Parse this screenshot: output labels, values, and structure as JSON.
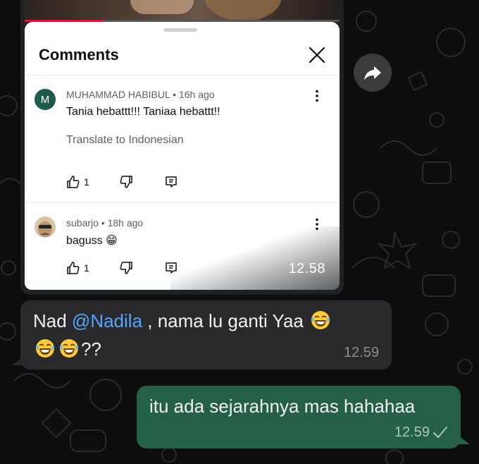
{
  "media": {
    "video_progress_fraction": 0.25,
    "comments_title": "Comments",
    "time": "12.58",
    "comments": [
      {
        "avatar_letter": "M",
        "avatar_color": "#1d5c4a",
        "author_meta": "MUHAMMAD HABIBUL • 16h ago",
        "text": "Tania hebattt!!! Taniaa hebattt!!",
        "translate": "Translate to Indonesian",
        "likes": "1"
      },
      {
        "avatar_color": "#c9b08f",
        "author_meta": "subarjo • 18h ago",
        "text": "baguss 😁",
        "likes": "1"
      }
    ]
  },
  "incoming_message": {
    "prefix": "Nad ",
    "mention": "@Nadila",
    "after_mention": " , nama lu ganti Yaa",
    "line2_suffix": "??",
    "time": "12.59"
  },
  "outgoing_message": {
    "text": "itu ada sejarahnya mas hahahaa",
    "time": "12.59",
    "status": "sent"
  },
  "colors": {
    "incoming_bubble": "#2a2a2c",
    "outgoing_bubble": "#245f47",
    "mention": "#53a6ff",
    "progress": "#ff0033"
  },
  "icons": [
    "close-icon",
    "more-vert-icon",
    "thumb-up-icon",
    "thumb-down-icon",
    "reply-icon",
    "forward-icon",
    "laughing-emoji-icon",
    "check-icon"
  ]
}
